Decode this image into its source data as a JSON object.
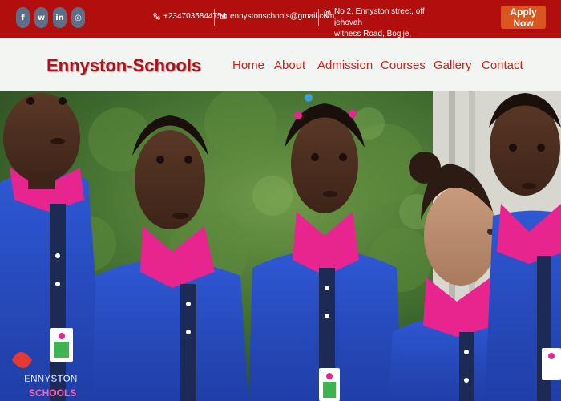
{
  "topbar": {
    "social": [
      {
        "name": "facebook-icon",
        "glyph": "f"
      },
      {
        "name": "whatsapp-icon",
        "glyph": "w"
      },
      {
        "name": "linkedin-icon",
        "glyph": "in"
      },
      {
        "name": "instagram-icon",
        "glyph": "◎"
      }
    ],
    "phone": "+2347035844754",
    "email": "ennystonschools@gmail.com",
    "address_line1": "No 2, Ennyston street, off jehovah",
    "address_line2": "witness Road, Bogije, Lagos.",
    "apply_label": "Apply Now"
  },
  "header": {
    "logo": "Ennyston-Schools",
    "nav": [
      "Home",
      "About",
      "Admission",
      "Courses",
      "Gallery",
      "Contact"
    ]
  },
  "colors": {
    "topbar": "#b30e0e",
    "apply_button": "#d9561e",
    "logo": "#b1121a",
    "nav_link": "#c4261d",
    "navbar_bg": "#f2f5f1",
    "uniform_blue": "#2a50c8",
    "collar_pink": "#e8248e"
  },
  "hero": {
    "badge_line1": "ENNYSTON",
    "badge_line2": "SCHOOLS"
  }
}
